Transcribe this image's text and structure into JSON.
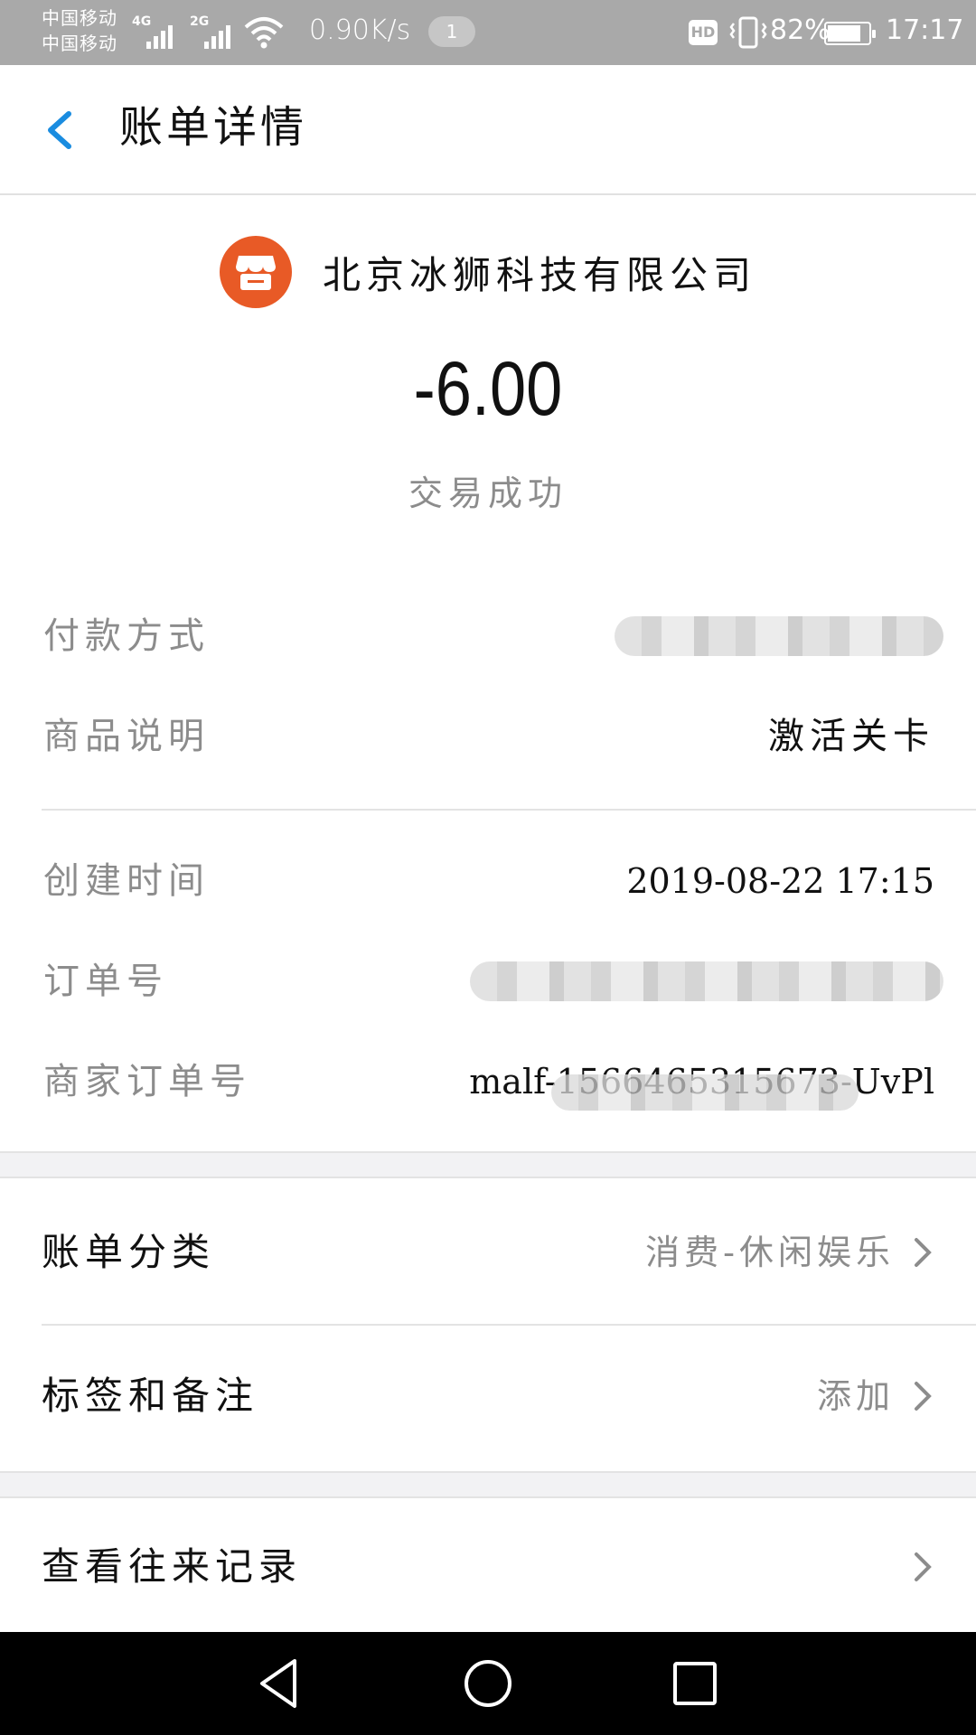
{
  "status_bar": {
    "carrier_1": "中国移动",
    "carrier_2": "中国移动",
    "signal_1_type": "4G",
    "signal_2_type": "2G",
    "network_speed": "0.90K/s",
    "notification_count": "1",
    "hd_label": "HD",
    "battery_percent": "82%",
    "battery_level": 0.82,
    "time": "17:17"
  },
  "header": {
    "back_icon": "chevron-left-icon",
    "title": "账单详情",
    "accent_color": "#1a8ce0"
  },
  "summary": {
    "merchant_icon": "shop-icon",
    "merchant_icon_color": "#e85a26",
    "merchant_name": "北京冰狮科技有限公司",
    "amount": "-6.00",
    "status": "交易成功"
  },
  "details": {
    "payment_method_label": "付款方式",
    "product_desc_label": "商品说明",
    "product_desc_value": "激活关卡",
    "created_time_label": "创建时间",
    "created_time_value": "2019-08-22 17:15",
    "order_no_label": "订单号",
    "merchant_order_no_label": "商家订单号",
    "merchant_order_no_value": "malf-1566465315673-UvPl"
  },
  "actions": {
    "bill_category_label": "账单分类",
    "bill_category_value": "消费-休闲娱乐",
    "tags_notes_label": "标签和备注",
    "tags_notes_value": "添加",
    "history_label": "查看往来记录"
  },
  "nav_bar": {
    "back_icon": "triangle-back-icon",
    "home_icon": "circle-home-icon",
    "recents_icon": "square-recents-icon"
  }
}
